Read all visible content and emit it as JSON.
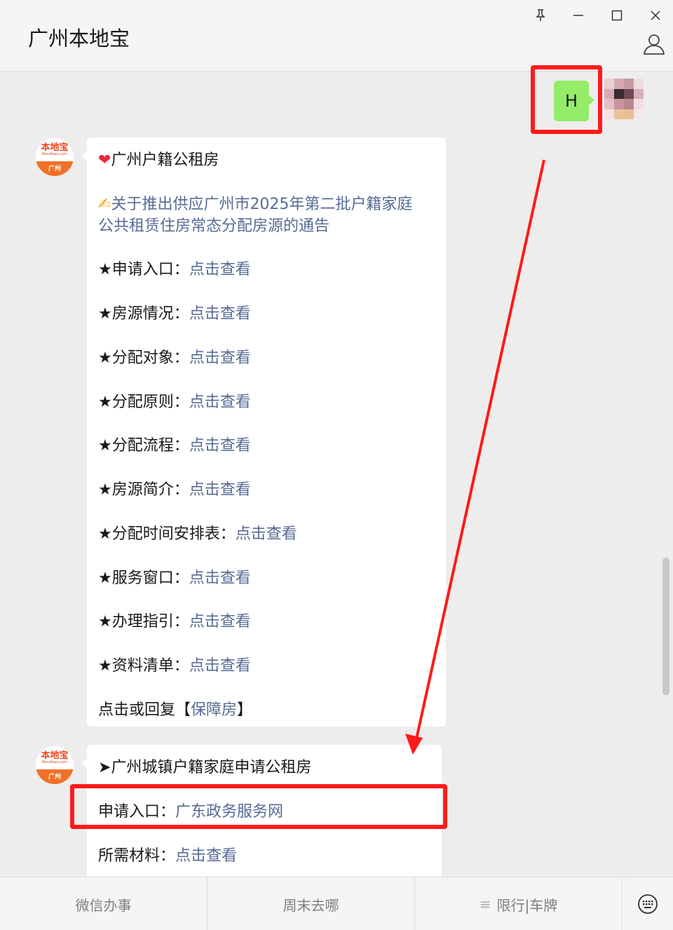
{
  "window": {
    "title": "广州本地宝",
    "controls": [
      "pin-icon",
      "minimize-icon",
      "maximize-icon",
      "close-icon"
    ],
    "profile_icon": "person-icon"
  },
  "outgoing": {
    "text": "H"
  },
  "bot": {
    "avatar_logo": "本地宝",
    "avatar_logo_sub": "Bendibao.com",
    "avatar_city": "广州"
  },
  "message1": {
    "title_icon": "❤",
    "title": "广州户籍公租房",
    "notice_icon": "✍",
    "notice_line1": "关于推出供应广州市2025年第二批户籍家庭",
    "notice_line2": "公共租赁住房常态分配房源的通告",
    "items": [
      {
        "label": "★申请入口：",
        "link": "点击查看"
      },
      {
        "label": "★房源情况：",
        "link": "点击查看"
      },
      {
        "label": "★分配对象：",
        "link": "点击查看"
      },
      {
        "label": "★分配原则：",
        "link": "点击查看"
      },
      {
        "label": "★分配流程：",
        "link": "点击查看"
      },
      {
        "label": "★房源简介：",
        "link": "点击查看"
      },
      {
        "label": "★分配时间安排表：",
        "link": "点击查看"
      },
      {
        "label": "★服务窗口：",
        "link": "点击查看"
      },
      {
        "label": "★办理指引：",
        "link": "点击查看"
      },
      {
        "label": "★资料清单：",
        "link": "点击查看"
      }
    ],
    "footer_prefix": "点击或回复【",
    "footer_link": "保障房",
    "footer_suffix": "】"
  },
  "message2": {
    "title": "➤广州城镇户籍家庭申请公租房",
    "apply_label": "申请入口：",
    "apply_link": "广东政务服务网",
    "materials_label": "所需材料：",
    "materials_link": "点击查看"
  },
  "bottom_menu": {
    "items": [
      "微信办事",
      "周末去哪",
      "限行|车牌"
    ],
    "item3_icon": "≡",
    "keyboard_icon": "keyboard-icon"
  },
  "colors": {
    "highlight": "#ff1a1a",
    "link": "#576b95",
    "outgoing_bubble": "#95ec69",
    "chat_bg": "#ededed"
  }
}
